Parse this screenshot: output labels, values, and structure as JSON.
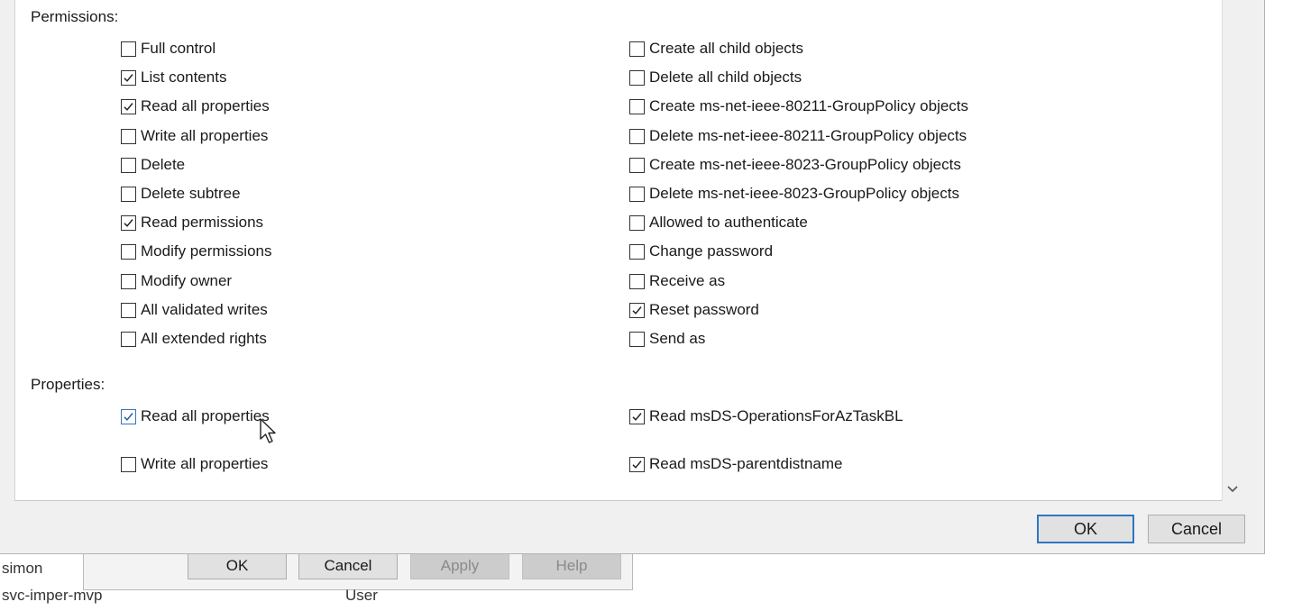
{
  "sections": {
    "permissions_label": "Permissions:",
    "properties_label": "Properties:"
  },
  "permissions": {
    "left": [
      {
        "label": "Full control",
        "checked": false
      },
      {
        "label": "List contents",
        "checked": true
      },
      {
        "label": "Read all properties",
        "checked": true
      },
      {
        "label": "Write all properties",
        "checked": false
      },
      {
        "label": "Delete",
        "checked": false
      },
      {
        "label": "Delete subtree",
        "checked": false
      },
      {
        "label": "Read permissions",
        "checked": true
      },
      {
        "label": "Modify permissions",
        "checked": false
      },
      {
        "label": "Modify owner",
        "checked": false
      },
      {
        "label": "All validated writes",
        "checked": false
      },
      {
        "label": "All extended rights",
        "checked": false
      }
    ],
    "right": [
      {
        "label": "Create all child objects",
        "checked": false
      },
      {
        "label": "Delete all child objects",
        "checked": false
      },
      {
        "label": "Create ms-net-ieee-80211-GroupPolicy objects",
        "checked": false
      },
      {
        "label": "Delete ms-net-ieee-80211-GroupPolicy objects",
        "checked": false
      },
      {
        "label": "Create ms-net-ieee-8023-GroupPolicy objects",
        "checked": false
      },
      {
        "label": "Delete ms-net-ieee-8023-GroupPolicy objects",
        "checked": false
      },
      {
        "label": "Allowed to authenticate",
        "checked": false
      },
      {
        "label": "Change password",
        "checked": false
      },
      {
        "label": "Receive as",
        "checked": false
      },
      {
        "label": "Reset password",
        "checked": true
      },
      {
        "label": "Send as",
        "checked": false
      }
    ]
  },
  "properties": {
    "left": [
      {
        "label": "Read all properties",
        "checked": true
      },
      {
        "label": "Write all properties",
        "checked": false
      }
    ],
    "right": [
      {
        "label": "Read msDS-OperationsForAzTaskBL",
        "checked": true
      },
      {
        "label": "Read msDS-parentdistname",
        "checked": true
      }
    ]
  },
  "dialog_buttons": {
    "ok": "OK",
    "cancel": "Cancel"
  },
  "background_window": {
    "buttons": [
      {
        "label": "OK",
        "enabled": true
      },
      {
        "label": "Cancel",
        "enabled": true
      },
      {
        "label": "Apply",
        "enabled": false
      },
      {
        "label": "Help",
        "enabled": false
      }
    ],
    "list": [
      {
        "name": "simon",
        "type": ""
      },
      {
        "name": "svc-imper-mvp",
        "type": "User"
      }
    ]
  },
  "colors": {
    "accent": "#2f76c4",
    "dialog_bg": "#f0f0f0"
  },
  "icons": {
    "checkmark": "checkmark-icon",
    "scroll_down": "chevron-down-icon",
    "cursor": "mouse-pointer-icon"
  }
}
